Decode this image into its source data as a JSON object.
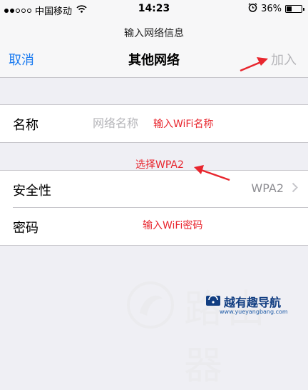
{
  "status_bar": {
    "carrier": "中国移动",
    "time": "14:23",
    "battery": "36%",
    "battery_level": 0.36,
    "icons": [
      "signal-dots-icon",
      "wifi-icon",
      "alarm-icon",
      "battery-icon"
    ]
  },
  "nav": {
    "prompt": "输入网络信息",
    "cancel_label": "取消",
    "title": "其他网络",
    "join_label": "加入"
  },
  "form": {
    "name": {
      "label": "名称",
      "placeholder": "网络名称",
      "value": ""
    },
    "security": {
      "label": "安全性",
      "value": "WPA2"
    },
    "password": {
      "label": "密码"
    }
  },
  "annotations": {
    "name_hint": "输入WiFi名称",
    "security_hint": "选择WPA2",
    "password_hint": "输入WiFi密码"
  },
  "watermark": {
    "text": "路由器",
    "site_name": "越有趣导航",
    "url": "www.yueyangbang.com"
  },
  "colors": {
    "accent": "#1d7cf0",
    "disabled": "#b5b5b9",
    "annotation": "#e8262e",
    "background": "#efeff4"
  }
}
